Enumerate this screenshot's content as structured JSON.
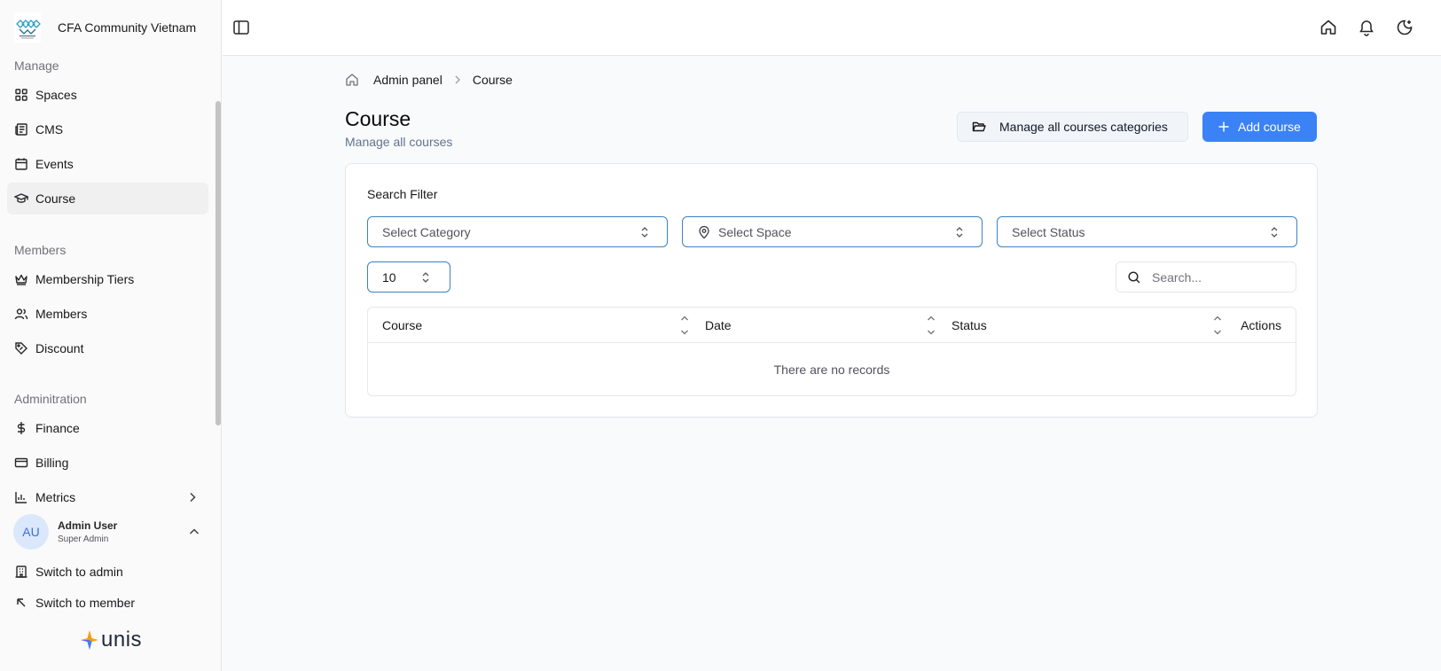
{
  "brand": {
    "name": "CFA Community Vietnam"
  },
  "sidebar": {
    "sections": [
      {
        "heading": "Manage",
        "items": [
          {
            "label": "Spaces",
            "icon": "grid-icon"
          },
          {
            "label": "CMS",
            "icon": "newspaper-icon"
          },
          {
            "label": "Events",
            "icon": "calendar-icon"
          },
          {
            "label": "Course",
            "icon": "graduation-cap-icon",
            "active": true
          }
        ]
      },
      {
        "heading": "Members",
        "items": [
          {
            "label": "Membership Tiers",
            "icon": "crown-icon"
          },
          {
            "label": "Members",
            "icon": "users-icon"
          },
          {
            "label": "Discount",
            "icon": "tag-discount-icon"
          }
        ]
      },
      {
        "heading": "Adminitration",
        "items": [
          {
            "label": "Finance",
            "icon": "dollar-icon"
          },
          {
            "label": "Billing",
            "icon": "credit-card-icon"
          },
          {
            "label": "Metrics",
            "icon": "chart-icon"
          }
        ]
      }
    ],
    "user": {
      "initials": "AU",
      "name": "Admin User",
      "role": "Super Admin"
    },
    "switch_admin": "Switch to admin",
    "switch_member": "Switch to member",
    "powered_by": "unis"
  },
  "breadcrumb": {
    "parent": "Admin panel",
    "current": "Course"
  },
  "page": {
    "title": "Course",
    "subtitle": "Manage all courses",
    "manage_categories_label": "Manage all courses categories",
    "add_label": "Add course"
  },
  "filters": {
    "label": "Search Filter",
    "category_placeholder": "Select Category",
    "space_placeholder": "Select Space",
    "status_placeholder": "Select Status",
    "page_size": "10",
    "search_placeholder": "Search..."
  },
  "table": {
    "columns": [
      "Course",
      "Date",
      "Status",
      "Actions"
    ],
    "empty_text": "There are no records"
  },
  "colors": {
    "primary": "#3b82f6",
    "focus_border": "#3b82c4",
    "active_bg": "#f0f0f1"
  }
}
